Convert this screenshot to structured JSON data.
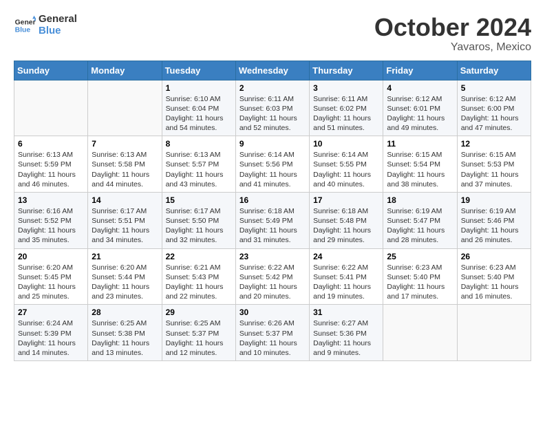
{
  "header": {
    "logo_line1": "General",
    "logo_line2": "Blue",
    "month": "October 2024",
    "location": "Yavaros, Mexico"
  },
  "days_of_week": [
    "Sunday",
    "Monday",
    "Tuesday",
    "Wednesday",
    "Thursday",
    "Friday",
    "Saturday"
  ],
  "weeks": [
    [
      {
        "day": "",
        "info": ""
      },
      {
        "day": "",
        "info": ""
      },
      {
        "day": "1",
        "info": "Sunrise: 6:10 AM\nSunset: 6:04 PM\nDaylight: 11 hours and 54 minutes."
      },
      {
        "day": "2",
        "info": "Sunrise: 6:11 AM\nSunset: 6:03 PM\nDaylight: 11 hours and 52 minutes."
      },
      {
        "day": "3",
        "info": "Sunrise: 6:11 AM\nSunset: 6:02 PM\nDaylight: 11 hours and 51 minutes."
      },
      {
        "day": "4",
        "info": "Sunrise: 6:12 AM\nSunset: 6:01 PM\nDaylight: 11 hours and 49 minutes."
      },
      {
        "day": "5",
        "info": "Sunrise: 6:12 AM\nSunset: 6:00 PM\nDaylight: 11 hours and 47 minutes."
      }
    ],
    [
      {
        "day": "6",
        "info": "Sunrise: 6:13 AM\nSunset: 5:59 PM\nDaylight: 11 hours and 46 minutes."
      },
      {
        "day": "7",
        "info": "Sunrise: 6:13 AM\nSunset: 5:58 PM\nDaylight: 11 hours and 44 minutes."
      },
      {
        "day": "8",
        "info": "Sunrise: 6:13 AM\nSunset: 5:57 PM\nDaylight: 11 hours and 43 minutes."
      },
      {
        "day": "9",
        "info": "Sunrise: 6:14 AM\nSunset: 5:56 PM\nDaylight: 11 hours and 41 minutes."
      },
      {
        "day": "10",
        "info": "Sunrise: 6:14 AM\nSunset: 5:55 PM\nDaylight: 11 hours and 40 minutes."
      },
      {
        "day": "11",
        "info": "Sunrise: 6:15 AM\nSunset: 5:54 PM\nDaylight: 11 hours and 38 minutes."
      },
      {
        "day": "12",
        "info": "Sunrise: 6:15 AM\nSunset: 5:53 PM\nDaylight: 11 hours and 37 minutes."
      }
    ],
    [
      {
        "day": "13",
        "info": "Sunrise: 6:16 AM\nSunset: 5:52 PM\nDaylight: 11 hours and 35 minutes."
      },
      {
        "day": "14",
        "info": "Sunrise: 6:17 AM\nSunset: 5:51 PM\nDaylight: 11 hours and 34 minutes."
      },
      {
        "day": "15",
        "info": "Sunrise: 6:17 AM\nSunset: 5:50 PM\nDaylight: 11 hours and 32 minutes."
      },
      {
        "day": "16",
        "info": "Sunrise: 6:18 AM\nSunset: 5:49 PM\nDaylight: 11 hours and 31 minutes."
      },
      {
        "day": "17",
        "info": "Sunrise: 6:18 AM\nSunset: 5:48 PM\nDaylight: 11 hours and 29 minutes."
      },
      {
        "day": "18",
        "info": "Sunrise: 6:19 AM\nSunset: 5:47 PM\nDaylight: 11 hours and 28 minutes."
      },
      {
        "day": "19",
        "info": "Sunrise: 6:19 AM\nSunset: 5:46 PM\nDaylight: 11 hours and 26 minutes."
      }
    ],
    [
      {
        "day": "20",
        "info": "Sunrise: 6:20 AM\nSunset: 5:45 PM\nDaylight: 11 hours and 25 minutes."
      },
      {
        "day": "21",
        "info": "Sunrise: 6:20 AM\nSunset: 5:44 PM\nDaylight: 11 hours and 23 minutes."
      },
      {
        "day": "22",
        "info": "Sunrise: 6:21 AM\nSunset: 5:43 PM\nDaylight: 11 hours and 22 minutes."
      },
      {
        "day": "23",
        "info": "Sunrise: 6:22 AM\nSunset: 5:42 PM\nDaylight: 11 hours and 20 minutes."
      },
      {
        "day": "24",
        "info": "Sunrise: 6:22 AM\nSunset: 5:41 PM\nDaylight: 11 hours and 19 minutes."
      },
      {
        "day": "25",
        "info": "Sunrise: 6:23 AM\nSunset: 5:40 PM\nDaylight: 11 hours and 17 minutes."
      },
      {
        "day": "26",
        "info": "Sunrise: 6:23 AM\nSunset: 5:40 PM\nDaylight: 11 hours and 16 minutes."
      }
    ],
    [
      {
        "day": "27",
        "info": "Sunrise: 6:24 AM\nSunset: 5:39 PM\nDaylight: 11 hours and 14 minutes."
      },
      {
        "day": "28",
        "info": "Sunrise: 6:25 AM\nSunset: 5:38 PM\nDaylight: 11 hours and 13 minutes."
      },
      {
        "day": "29",
        "info": "Sunrise: 6:25 AM\nSunset: 5:37 PM\nDaylight: 11 hours and 12 minutes."
      },
      {
        "day": "30",
        "info": "Sunrise: 6:26 AM\nSunset: 5:37 PM\nDaylight: 11 hours and 10 minutes."
      },
      {
        "day": "31",
        "info": "Sunrise: 6:27 AM\nSunset: 5:36 PM\nDaylight: 11 hours and 9 minutes."
      },
      {
        "day": "",
        "info": ""
      },
      {
        "day": "",
        "info": ""
      }
    ]
  ]
}
